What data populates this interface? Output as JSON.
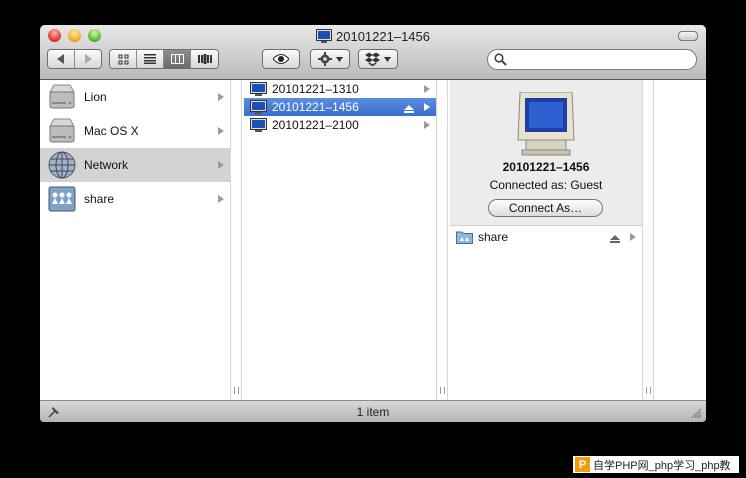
{
  "window": {
    "title": "20101221–1456"
  },
  "toolbar": {
    "back_icon": "back-arrow-icon",
    "forward_icon": "forward-arrow-icon",
    "view_modes": [
      "icon-view",
      "list-view",
      "column-view",
      "coverflow-view"
    ],
    "active_view": "column-view",
    "quicklook_icon": "eye-icon",
    "action_icon": "gear-icon",
    "dropbox_icon": "dropbox-icon",
    "search": {
      "value": "",
      "placeholder": ""
    }
  },
  "sidebar": {
    "items": [
      {
        "label": "Lion",
        "icon": "hard-drive-icon",
        "selected": false
      },
      {
        "label": "Mac OS X",
        "icon": "hard-drive-icon",
        "selected": false
      },
      {
        "label": "Network",
        "icon": "network-globe-icon",
        "selected": true
      },
      {
        "label": "share",
        "icon": "shared-folder-icon",
        "selected": false
      }
    ]
  },
  "column2": {
    "items": [
      {
        "label": "20101221–1310",
        "selected": false,
        "eject": false
      },
      {
        "label": "20101221–1456",
        "selected": true,
        "eject": true
      },
      {
        "label": "20101221–2100",
        "selected": false,
        "eject": false
      }
    ]
  },
  "preview": {
    "name": "20101221–1456",
    "connected_as": "Connected as: Guest",
    "connect_button": "Connect As…"
  },
  "column3": {
    "items": [
      {
        "label": "share",
        "icon": "shared-folder-icon",
        "eject": true
      }
    ]
  },
  "status": {
    "text": "1 item"
  },
  "watermark": {
    "text": "自学PHP网_php学习_php教"
  },
  "colors": {
    "selection": "#3a6ed0",
    "sidebar_selected": "#d3d3d3",
    "titlebar": "#cfcfcf"
  }
}
